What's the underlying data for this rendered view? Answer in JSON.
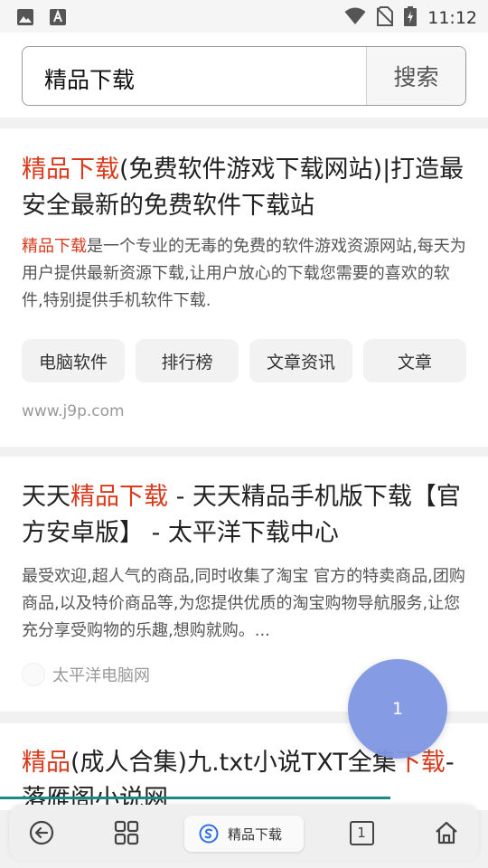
{
  "status_bar": {
    "time": "11:12",
    "icons": [
      "image-icon",
      "font-download-icon",
      "wifi-icon",
      "no-sim-icon",
      "battery-charging-icon"
    ]
  },
  "search": {
    "query": "精品下载",
    "button_label": "搜索"
  },
  "results": [
    {
      "title_highlight": "精品下载",
      "title_rest": "(免费软件游戏下载网站)|打造最安全最新的免费软件下载站",
      "desc_highlight": "精品下载",
      "desc_rest": "是一个专业的无毒的免费的软件游戏资源网站,每天为用户提供最新资源下载,让用户放心的下载您需要的喜欢的软件,特别提供手机软件下载.",
      "chips": [
        "电脑软件",
        "排行榜",
        "文章资讯",
        "文章"
      ],
      "url": "www.j9p.com"
    },
    {
      "title_pre": "天天",
      "title_highlight": "精品下载",
      "title_rest": " - 天天精品手机版下载【官方安卓版】 - 太平洋下载中心",
      "desc": "最受欢迎,超人气的商品,同时收集了淘宝 官方的特卖商品,团购商品,以及特价商品等,为您提供优质的淘宝购物导航服务,让您充分享受购物的乐趣,想购就购。...",
      "source": "太平洋电脑网"
    },
    {
      "title_highlight": "精品",
      "title_mid": "(成人合集)九.txt小说TXT全集",
      "title_highlight2": "下载",
      "title_rest": "-落雁阁小说网"
    }
  ],
  "fab": {
    "label": "1"
  },
  "bottom_bar": {
    "back_icon": "back-circle-icon",
    "apps_icon": "grid-icon",
    "current_tab_label": "精品下载",
    "tab_count": "1",
    "home_icon": "home-icon"
  },
  "colors": {
    "highlight": "#d93a1c",
    "fab": "#7e96e1",
    "progress": "#1a8a82"
  }
}
